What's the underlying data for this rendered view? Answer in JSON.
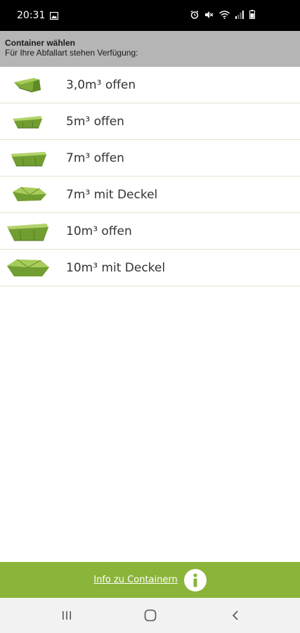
{
  "status_bar": {
    "time": "20:31"
  },
  "header": {
    "title": "Container wählen",
    "subtitle": "Für Ihre Abfallart stehen Verfügung:"
  },
  "containers": [
    {
      "label": "3,0m³ offen",
      "icon": "small-open-container-icon"
    },
    {
      "label": "5m³ offen",
      "icon": "open-container-icon"
    },
    {
      "label": "7m³ offen",
      "icon": "open-container-icon"
    },
    {
      "label": "7m³ mit Deckel",
      "icon": "lidded-container-icon"
    },
    {
      "label": "10m³ offen",
      "icon": "large-open-container-icon"
    },
    {
      "label": "10m³ mit Deckel",
      "icon": "large-lidded-container-icon"
    }
  ],
  "footer": {
    "link_label": "Info zu Containern",
    "icon": "info-icon"
  },
  "navigation": {
    "icons": [
      "recent-apps-icon",
      "home-icon",
      "back-icon"
    ]
  },
  "colors": {
    "accent_green": "#8bb43a",
    "container_green": "#7eaa3a",
    "header_gray": "#b5b5b5"
  }
}
